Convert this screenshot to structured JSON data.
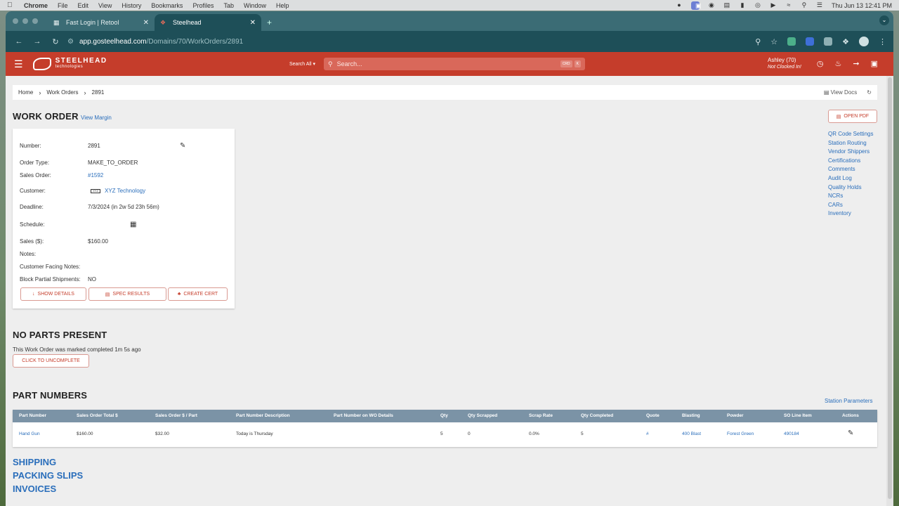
{
  "menubar": {
    "app": "Chrome",
    "items": [
      "File",
      "Edit",
      "View",
      "History",
      "Bookmarks",
      "Profiles",
      "Tab",
      "Window",
      "Help"
    ],
    "clock": "Thu Jun 13  12:41 PM"
  },
  "tabs": [
    {
      "label": "Fast Login | Retool"
    },
    {
      "label": "Steelhead"
    }
  ],
  "address": {
    "domain": "app.gosteelhead.com",
    "path": "/Domains/70/WorkOrders/2891"
  },
  "header": {
    "logo_text": "STEELHEAD",
    "logo_sub": "technologies",
    "search_all": "Search All",
    "search_placeholder": "Search...",
    "key1": "CRD",
    "key2": "K",
    "user_name": "Ashley (70)",
    "user_status": "Not Clocked In!"
  },
  "breadcrumb": {
    "items": [
      "Home",
      "Work Orders",
      "2891"
    ],
    "view_docs": "View Docs"
  },
  "work_order": {
    "heading": "WORK ORDER",
    "view_margin": "View Margin",
    "number_label": "Number:",
    "number": "2891",
    "order_type_label": "Order Type:",
    "order_type": "MAKE_TO_ORDER",
    "sales_order_label": "Sales Order:",
    "sales_order": "#1592",
    "customer_label": "Customer:",
    "customer_logo": "XYZ",
    "customer": "XYZ Technology",
    "deadline_label": "Deadline:",
    "deadline": "7/3/2024 (in 2w 5d 23h 56m)",
    "schedule_label": "Schedule:",
    "sales_label": "Sales ($):",
    "sales": "$160.00",
    "notes_label": "Notes:",
    "cf_notes_label": "Customer Facing Notes:",
    "block_label": "Block Partial Shipments:",
    "block": "NO",
    "show_details": "SHOW DETAILS",
    "spec_results": "SPEC RESULTS",
    "create_cert": "CREATE CERT"
  },
  "sidebar_links": {
    "open_pdf": "OPEN PDF",
    "links": [
      "QR Code Settings",
      "Station Routing",
      "Vendor Shippers",
      "Certifications",
      "Comments",
      "Audit Log",
      "Quality Holds",
      "NCRs",
      "CARs",
      "Inventory"
    ]
  },
  "no_parts": {
    "heading": "NO PARTS PRESENT",
    "text": "This Work Order was marked completed 1m 5s ago",
    "button": "CLICK TO UNCOMPLETE"
  },
  "part_numbers": {
    "heading": "PART NUMBERS",
    "station_params": "Station Parameters",
    "columns": [
      "Part Number",
      "Sales Order Total $",
      "Sales Order $ / Part",
      "Part Number Description",
      "Part Number on WO Details",
      "Qty",
      "Qty Scrapped",
      "Scrap Rate",
      "Qty Completed",
      "Quote",
      "Blasting",
      "Powder",
      "SO Line Item",
      "Actions"
    ],
    "row": {
      "part_number": "Hand Gun",
      "so_total": "$160.00",
      "so_per_part": "$32.00",
      "description": "Today is Thursday",
      "wo_details": "",
      "qty": "5",
      "qty_scrapped": "0",
      "scrap_rate": "0.0%",
      "qty_completed": "5",
      "quote": "#",
      "blasting": "400 Blast",
      "powder": "Forest Green",
      "so_line_item": "490184"
    }
  },
  "sections": {
    "shipping": "SHIPPING",
    "packing_slips": "PACKING SLIPS",
    "invoices": "INVOICES"
  }
}
